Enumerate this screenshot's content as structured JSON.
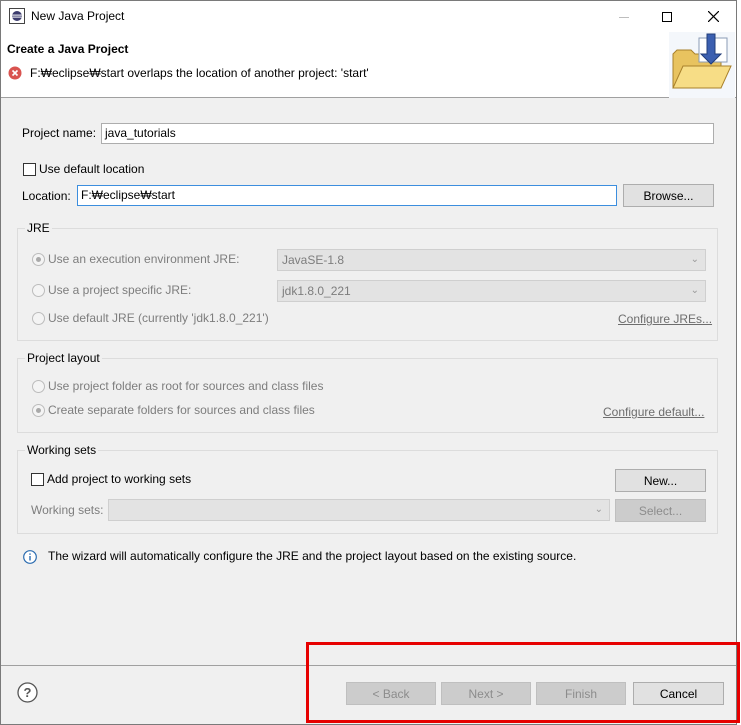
{
  "window": {
    "title": "New Java Project"
  },
  "banner": {
    "title": "Create a Java Project",
    "error_message": "F:₩eclipse₩start overlaps the location of another project: 'start'"
  },
  "project": {
    "name_label": "Project name:",
    "name_value": "java_tutorials",
    "use_default_location_label": "Use default location",
    "use_default_location_checked": false,
    "location_label": "Location:",
    "location_value": "F:₩eclipse₩start",
    "browse_label": "Browse..."
  },
  "jre": {
    "group_title": "JRE",
    "exec_env_label": "Use an execution environment JRE:",
    "exec_env_value": "JavaSE-1.8",
    "project_specific_label": "Use a project specific JRE:",
    "project_specific_value": "jdk1.8.0_221",
    "default_jre_label": "Use default JRE (currently 'jdk1.8.0_221')",
    "configure_link": "Configure JREs..."
  },
  "layout": {
    "group_title": "Project layout",
    "root_label": "Use project folder as root for sources and class files",
    "separate_label": "Create separate folders for sources and class files",
    "configure_link": "Configure default..."
  },
  "working_sets": {
    "group_title": "Working sets",
    "add_label": "Add project to working sets",
    "add_checked": false,
    "new_label": "New...",
    "sets_label": "Working sets:",
    "select_label": "Select..."
  },
  "info": {
    "message": "The wizard will automatically configure the JRE and the project layout based on the existing source."
  },
  "footer": {
    "back_label": "< Back",
    "next_label": "Next >",
    "finish_label": "Finish",
    "cancel_label": "Cancel"
  },
  "colors": {
    "highlight": "#e60000",
    "error": "#d9534f",
    "info": "#2b6cb0"
  }
}
